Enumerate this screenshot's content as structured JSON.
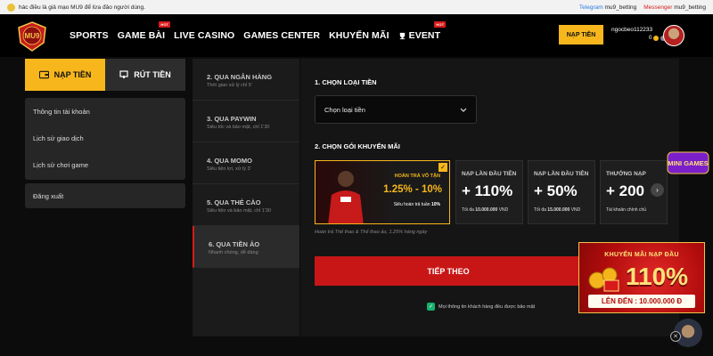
{
  "topbar": {
    "marquee": "hác điều là giả mạo MU9 để lừa đảo người dùng.",
    "telegram_label": "Telegram",
    "telegram_handle": "mu9_betting",
    "messenger_label": "Messenger",
    "messenger_handle": "mu9_betting"
  },
  "header": {
    "logo_text": "MU9",
    "nav": [
      {
        "label": "SPORTS",
        "hot": ""
      },
      {
        "label": "GAME BÀI",
        "hot": "HOT"
      },
      {
        "label": "LIVE CASINO",
        "hot": ""
      },
      {
        "label": "GAMES CENTER",
        "hot": ""
      },
      {
        "label": "KHUYẾN MÃI",
        "hot": ""
      },
      {
        "label": "EVENT",
        "hot": "HOT"
      }
    ],
    "deposit_button": "NẠP TIỀN",
    "username": "ngocbeo112233",
    "balance": "0"
  },
  "sidebar": {
    "tab_deposit": "NẠP TIỀN",
    "tab_withdraw": "RÚT TIỀN",
    "menu": [
      "Thông tin tài khoản",
      "Lịch sử giao dịch",
      "Lịch sử chơi game"
    ],
    "logout": "Đăng xuất"
  },
  "methods": [
    {
      "title": "2. QUA NGÂN HÀNG",
      "sub": "Thời gian xử lý chỉ 5'"
    },
    {
      "title": "3. QUA PAYWIN",
      "sub": "Siêu tốc và bảo mật, chỉ 1'30"
    },
    {
      "title": "4. QUA MOMO",
      "sub": "Siêu tiện lợi, xử lý 3'"
    },
    {
      "title": "5. QUA THẺ CÀO",
      "sub": "Siêu tiện và bảo mật, chỉ 1'30"
    },
    {
      "title": "6. QUA TIỀN ẢO",
      "sub": "Nhanh chóng, dễ dàng"
    }
  ],
  "main": {
    "section1_title": "1. CHỌN LOẠI TIỀN",
    "currency_select": "Chọn loại tiền",
    "section2_title": "2. CHỌN GÓI KHUYẾN MÃI",
    "promo_main": {
      "title": "HOÀN TRẢ VÔ TẬN",
      "range": "1.25% - 10%",
      "sub_prefix": "Siêu hoàn trả tuần",
      "sub_value": "10%"
    },
    "promo_cards": [
      {
        "title": "NẠP LẦN ĐẦU TIÊN",
        "pct": "+ 110%",
        "sub_prefix": "Tối đa",
        "sub_value": "10.000.000",
        "sub_unit": "VND"
      },
      {
        "title": "NẠP LẦN ĐẦU TIÊN",
        "pct": "+ 50%",
        "sub_prefix": "Tối đa",
        "sub_value": "15.000.000",
        "sub_unit": "VND"
      },
      {
        "title": "THƯỞNG NẠP",
        "pct": "+ 200",
        "sub_prefix": "Tài khoản chính chủ",
        "sub_value": "",
        "sub_unit": ""
      }
    ],
    "note": "Hoàn trả Thể thao & Thể thao ảo, 1.25% hàng ngày",
    "next_button": "TIẾP THEO",
    "secure_text": "Mọi thông tin khách hàng đều được bảo mật"
  },
  "floating": {
    "minigames": "MINI GAMES",
    "ad_title": "KHUYẾN MÃI NẠP ĐẦU",
    "ad_pct": "110%",
    "ad_foot": "LÊN ĐẾN : 10.000.000 Đ",
    "colors": {
      "brand_gold": "#f7b71c",
      "brand_red": "#c81616",
      "secure_green": "#18b06c"
    }
  }
}
